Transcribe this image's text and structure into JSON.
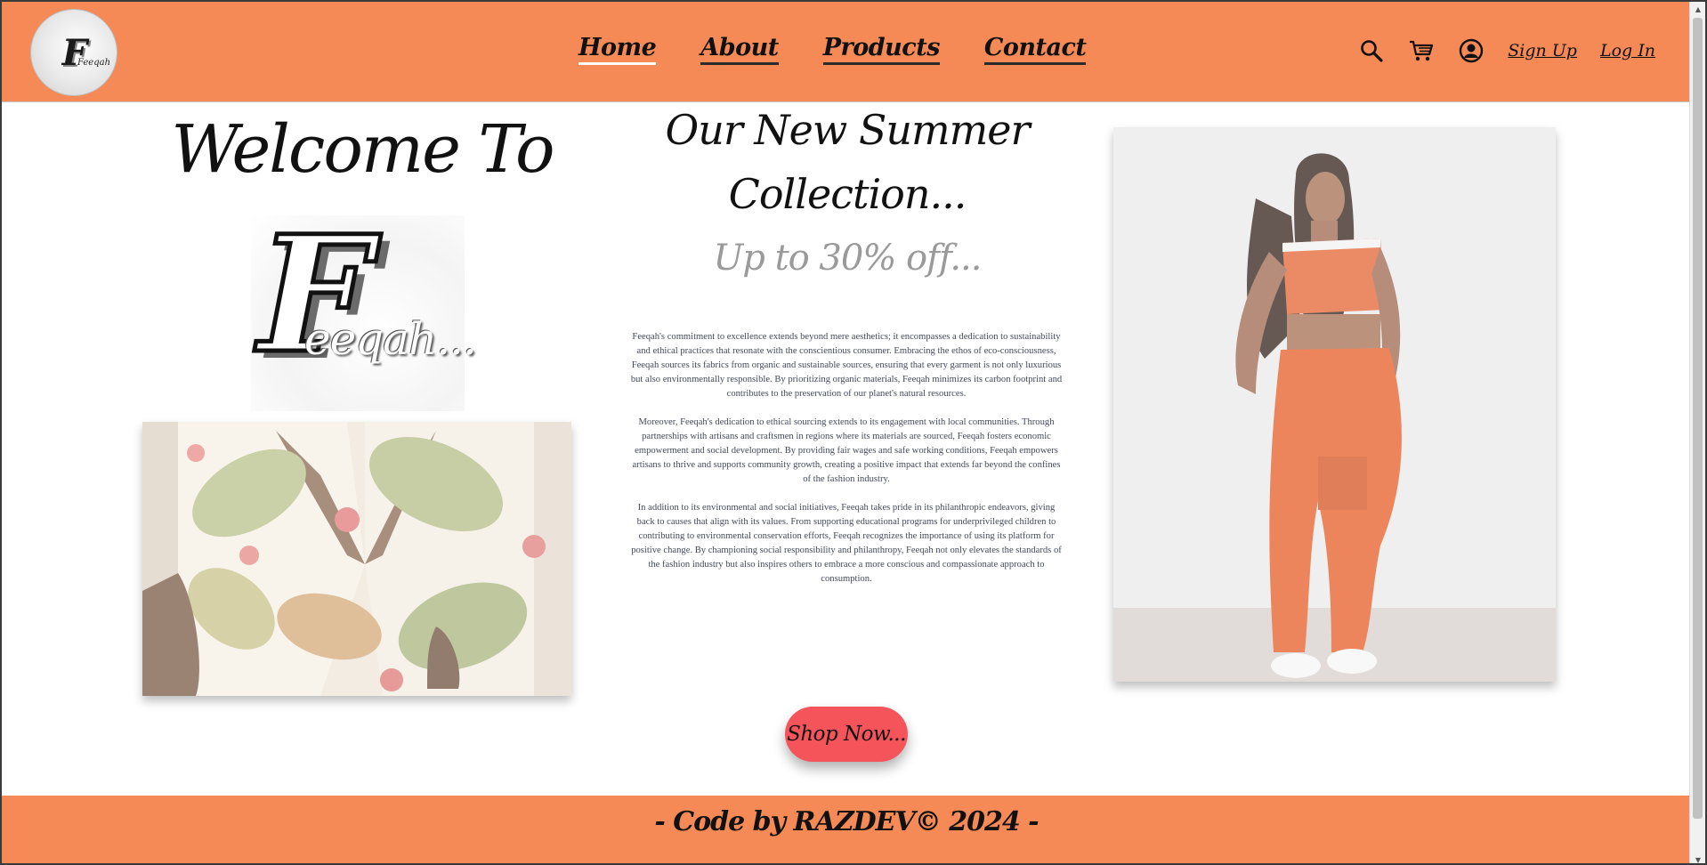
{
  "header": {
    "logo_text": "Feeqah",
    "nav": [
      {
        "label": "Home",
        "active": true
      },
      {
        "label": "About",
        "active": false
      },
      {
        "label": "Products",
        "active": false
      },
      {
        "label": "Contact",
        "active": false
      }
    ],
    "icons": [
      "search-icon",
      "cart-icon",
      "user-icon"
    ],
    "sign_up": "Sign Up",
    "log_in": "Log In"
  },
  "hero": {
    "welcome": "Welcome To",
    "brand_initial": "F",
    "brand_name": "eeqah..."
  },
  "collection": {
    "title": "Our New Summer Collection...",
    "discount": "Up to 30% off...",
    "paragraphs": [
      "Feeqah's commitment to excellence extends beyond mere aesthetics; it encompasses a dedication to sustainability and ethical practices that resonate with the conscientious consumer. Embracing the ethos of eco-consciousness, Feeqah sources its fabrics from organic and sustainable sources, ensuring that every garment is not only luxurious but also environmentally responsible. By prioritizing organic materials, Feeqah minimizes its carbon footprint and contributes to the preservation of our planet's natural resources.",
      "Moreover, Feeqah's dedication to ethical sourcing extends to its engagement with local communities. Through partnerships with artisans and craftsmen in regions where its materials are sourced, Feeqah fosters economic empowerment and social development. By providing fair wages and safe working conditions, Feeqah empowers artisans to thrive and supports community growth, creating a positive impact that extends far beyond the confines of the fashion industry.",
      "In addition to its environmental and social initiatives, Feeqah takes pride in its philanthropic endeavors, giving back to causes that align with its values. From supporting educational programs for underprivileged children to contributing to environmental conservation efforts, Feeqah recognizes the importance of using its platform for positive change. By championing social responsibility and philanthropy, Feeqah not only elevates the standards of the fashion industry but also inspires others to embrace a more conscious and compassionate approach to consumption."
    ],
    "cta": "Shop Now..."
  },
  "footer": {
    "text": "- Code by RAZDEV© 2024 -"
  },
  "colors": {
    "header_bg": "#f58a56",
    "cta_bg": "#f4545a",
    "discount_text": "#9a9a9a"
  }
}
